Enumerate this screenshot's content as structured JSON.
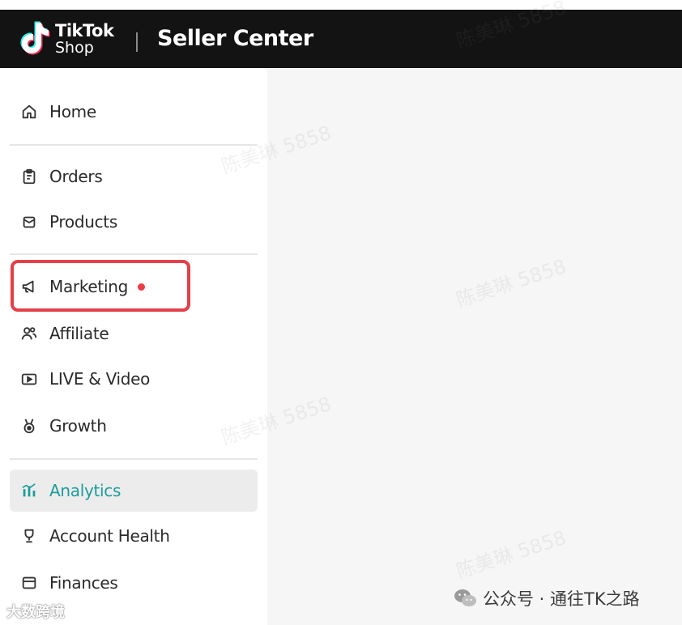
{
  "header": {
    "brand_line1": "TikTok",
    "brand_line2": "Shop",
    "title": "Seller Center"
  },
  "sidebar": {
    "items": [
      {
        "label": "Home",
        "icon": "home-icon"
      },
      {
        "label": "Orders",
        "icon": "clipboard-icon"
      },
      {
        "label": "Products",
        "icon": "box-icon"
      },
      {
        "label": "Marketing",
        "icon": "megaphone-icon",
        "badge": "red-dot"
      },
      {
        "label": "Affiliate",
        "icon": "people-icon"
      },
      {
        "label": "LIVE & Video",
        "icon": "video-play-icon"
      },
      {
        "label": "Growth",
        "icon": "medal-icon"
      },
      {
        "label": "Analytics",
        "icon": "bar-chart-icon",
        "active": true
      },
      {
        "label": "Account Health",
        "icon": "trophy-icon"
      },
      {
        "label": "Finances",
        "icon": "wallet-icon"
      }
    ]
  },
  "watermark": {
    "text": "陈美琳 5858"
  },
  "footer": {
    "left_text": "大数跨境",
    "right_text": "公众号 · 通往TK之路"
  },
  "colors": {
    "topbar": "#131313",
    "accent_active": "#1e9c9c",
    "highlight": "#e4404a",
    "badge": "#ef3b45"
  }
}
